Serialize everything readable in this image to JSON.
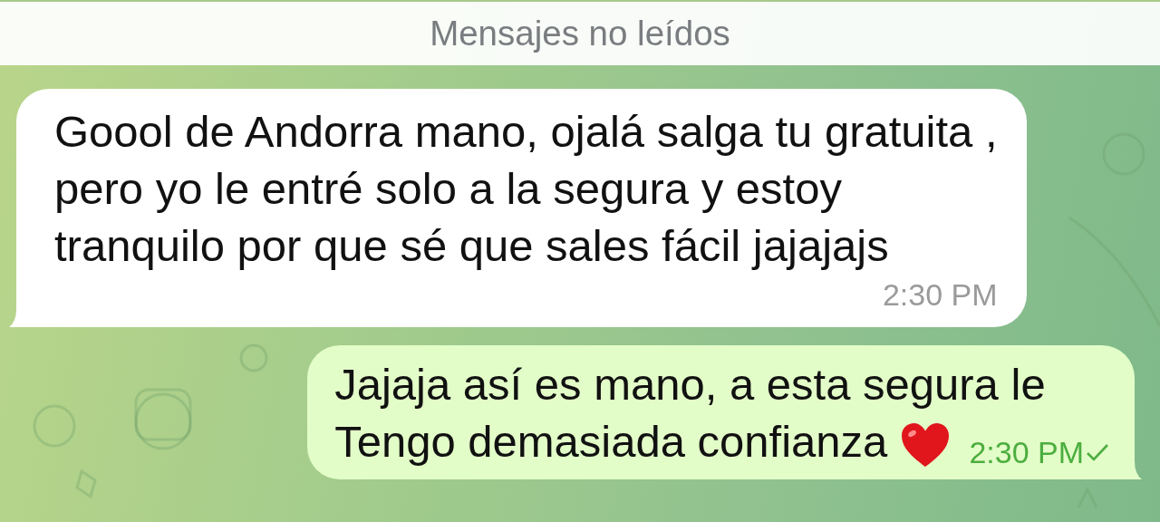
{
  "banner": "Mensajes no leídos",
  "messages": [
    {
      "outgoing": false,
      "lines": [
        "Goool de Andorra mano, ojalá salga tu gratuita ,",
        "pero yo le entré solo a la segura y estoy",
        "tranquilo por que sé que sales fácil jajajajs"
      ],
      "time": "2:30 PM"
    },
    {
      "outgoing": true,
      "lines": [
        "Jajaja así es mano, a esta segura le",
        "Tengo demasiada confianza"
      ],
      "heart": true,
      "time": "2:30 PM",
      "sent": true
    }
  ]
}
